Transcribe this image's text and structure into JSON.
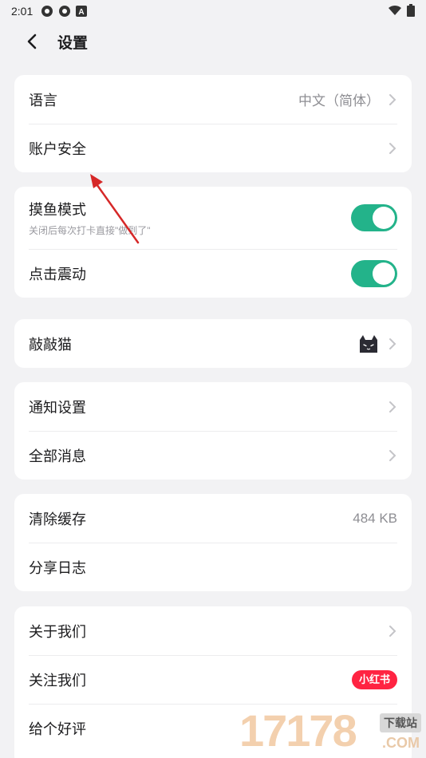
{
  "status_bar": {
    "time": "2:01",
    "icons": [
      "aperture-icon",
      "aperture-icon",
      "a-box-icon"
    ],
    "right_icons": [
      "wifi-icon",
      "battery-icon"
    ]
  },
  "header": {
    "title": "设置",
    "back_icon": "chevron-left-icon"
  },
  "sections": {
    "language": {
      "label": "语言",
      "value": "中文（简体）"
    },
    "account_security": {
      "label": "账户安全"
    },
    "slack_mode": {
      "label": "摸鱼模式",
      "subtitle": "关闭后每次打卡直接\"做到了\"",
      "enabled": true
    },
    "vibration": {
      "label": "点击震动",
      "enabled": true
    },
    "cat": {
      "label": "敲敲猫",
      "icon": "black-cat-icon"
    },
    "notifications": {
      "label": "通知设置"
    },
    "all_messages": {
      "label": "全部消息"
    },
    "clear_cache": {
      "label": "清除缓存",
      "value": "484 KB"
    },
    "share_log": {
      "label": "分享日志"
    },
    "about": {
      "label": "关于我们"
    },
    "follow": {
      "label": "关注我们",
      "badge": "小红书"
    },
    "rate": {
      "label": "给个好评"
    }
  },
  "watermark": {
    "digits": "17178",
    "tag": "下载站",
    "domain": ".COM"
  },
  "colors": {
    "toggle_on": "#23b38a",
    "badge": "#ff2442",
    "annotation_arrow": "#d62828",
    "background": "#f2f2f4"
  }
}
